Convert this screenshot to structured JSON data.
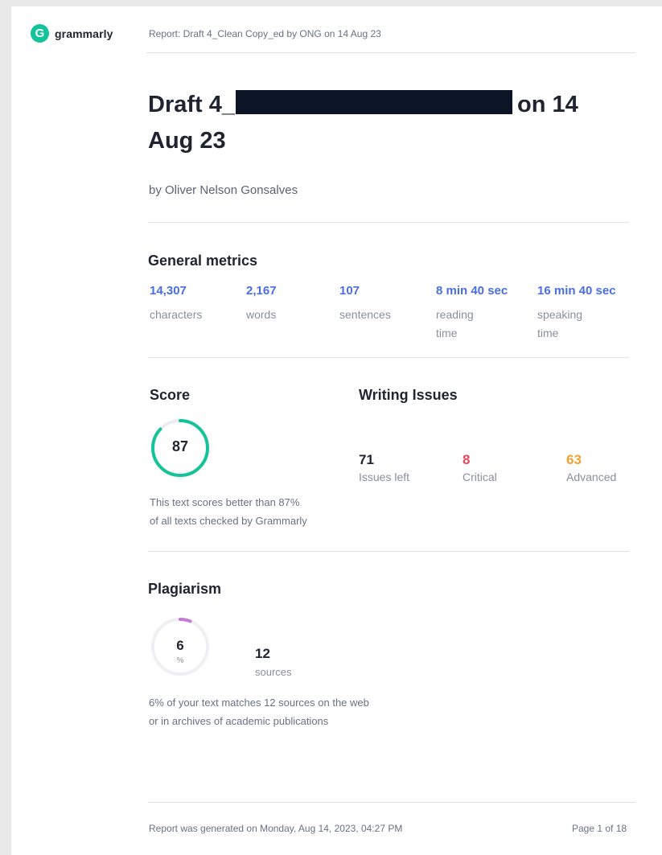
{
  "brand": {
    "logo_letter": "G",
    "name": "grammarly",
    "color": "#15c39a"
  },
  "header": {
    "report_line": "Report: Draft 4_Clean Copy_ed by ONG on 14 Aug 23"
  },
  "document": {
    "title_start": "Draft 4_",
    "title_end": "on 14 Aug 23",
    "author": "by Oliver Nelson Gonsalves"
  },
  "general_metrics": {
    "heading": "General metrics",
    "items": [
      {
        "value": "14,307",
        "label": "characters"
      },
      {
        "value": "2,167",
        "label": "words"
      },
      {
        "value": "107",
        "label": "sentences"
      },
      {
        "value": "8 min 40 sec",
        "label": "reading time"
      },
      {
        "value": "16 min 40 sec",
        "label": "speaking time"
      }
    ],
    "value_color": "#4a6ee0"
  },
  "score": {
    "heading": "Score",
    "value": "87",
    "percent": 87,
    "ring_color": "#15c39a",
    "note_line1": "This text scores better than 87%",
    "note_line2": "of all texts checked by Grammarly"
  },
  "writing_issues": {
    "heading": "Writing Issues",
    "items": [
      {
        "value": "71",
        "label": "Issues left",
        "color": "#1f2430"
      },
      {
        "value": "8",
        "label": "Critical",
        "color": "#e5475b"
      },
      {
        "value": "63",
        "label": "Advanced",
        "color": "#f0a22e"
      }
    ]
  },
  "plagiarism": {
    "heading": "Plagiarism",
    "value": "6",
    "unit": "%",
    "percent": 6,
    "ring_color": "#c47bd6",
    "sources_value": "12",
    "sources_label": "sources",
    "note_line1": "6% of your text matches 12 sources on the web",
    "note_line2": "or in archives of academic publications"
  },
  "footer": {
    "generated": "Report was generated on Monday, Aug 14, 2023, 04:27 PM",
    "page": "Page 1 of 18"
  }
}
